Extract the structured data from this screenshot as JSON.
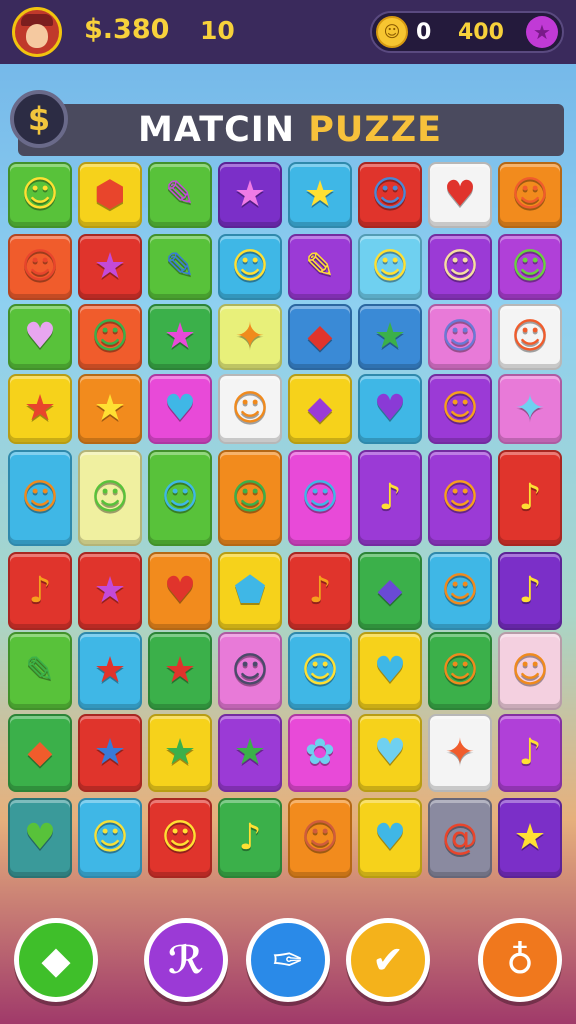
{
  "hud": {
    "money": "$.380",
    "level": "10",
    "coin_icon": "smiley-coin-icon",
    "coins": "0",
    "gems": "400",
    "gem_icon": "purple-star-icon"
  },
  "title": {
    "part1": "MATCIN",
    "part2": "PUZZE",
    "dollar_symbol": "$"
  },
  "board": {
    "rows": [
      [
        {
          "c": "#58c23a",
          "g": "☺",
          "gc": "#ffe033"
        },
        {
          "c": "#f6d21b",
          "g": "⬢",
          "gc": "#e8452c"
        },
        {
          "c": "#58c23a",
          "g": "✎",
          "gc": "#c44ad8"
        },
        {
          "c": "#7b2fc8",
          "g": "★",
          "gc": "#f07be6"
        },
        {
          "c": "#3fb7e6",
          "g": "★",
          "gc": "#ffe033"
        },
        {
          "c": "#e0342c",
          "g": "☺",
          "gc": "#4a88d6"
        },
        {
          "c": "#f4f4f4",
          "g": "♥",
          "gc": "#e0342c"
        },
        {
          "c": "#f28b1d",
          "g": "☺",
          "gc": "#f05c2c"
        }
      ],
      [
        {
          "c": "#f05c2c",
          "g": "☺",
          "gc": "#e8452c"
        },
        {
          "c": "#e0342c",
          "g": "★",
          "gc": "#c44ad8"
        },
        {
          "c": "#58c23a",
          "g": "✎",
          "gc": "#3a7ad6"
        },
        {
          "c": "#3fb7e6",
          "g": "☺",
          "gc": "#ffe033"
        },
        {
          "c": "#9b3ad6",
          "g": "✎",
          "gc": "#ffe033"
        },
        {
          "c": "#6fd0f0",
          "g": "☺",
          "gc": "#ffe033"
        },
        {
          "c": "#9b3ad6",
          "g": "☺",
          "gc": "#f6e0a0"
        },
        {
          "c": "#b040d8",
          "g": "☺",
          "gc": "#6ad040"
        }
      ],
      [
        {
          "c": "#58c23a",
          "g": "♥",
          "gc": "#e7a6f0"
        },
        {
          "c": "#f05c2c",
          "g": "☺",
          "gc": "#3bb04a"
        },
        {
          "c": "#3bb04a",
          "g": "★",
          "gc": "#e84ad8"
        },
        {
          "c": "#e8f07a",
          "g": "✦",
          "gc": "#f08a1d"
        },
        {
          "c": "#3a8ad6",
          "g": "⬥",
          "gc": "#e0342c"
        },
        {
          "c": "#3a8ad6",
          "g": "★",
          "gc": "#3bb04a"
        },
        {
          "c": "#e87ad8",
          "g": "☺",
          "gc": "#6a7ad6"
        },
        {
          "c": "#f4f4f4",
          "g": "☺",
          "gc": "#f05c2c"
        }
      ],
      [
        {
          "c": "#f6d21b",
          "g": "★",
          "gc": "#e8452c"
        },
        {
          "c": "#f28b1d",
          "g": "★",
          "gc": "#ffe033"
        },
        {
          "c": "#e84ad8",
          "g": "♥",
          "gc": "#3fb7e6"
        },
        {
          "c": "#f4f4f4",
          "g": "☺",
          "gc": "#f08a1d"
        },
        {
          "c": "#f6d21b",
          "g": "⬥",
          "gc": "#9b3ad6"
        },
        {
          "c": "#3fb7e6",
          "g": "♥",
          "gc": "#8a3ad6"
        },
        {
          "c": "#9b3ad6",
          "g": "☺",
          "gc": "#f6a01d"
        },
        {
          "c": "#e87ad8",
          "g": "✦",
          "gc": "#6fd0f0"
        }
      ],
      [
        {
          "c": "#3fb7e6",
          "g": "☺",
          "gc": "#f08a1d"
        },
        {
          "c": "#f0f0a0",
          "g": "☺",
          "gc": "#58c23a"
        },
        {
          "c": "#58c23a",
          "g": "☺",
          "gc": "#3fb7e6"
        },
        {
          "c": "#f28b1d",
          "g": "☺",
          "gc": "#3bb04a"
        },
        {
          "c": "#e84ad8",
          "g": "☺",
          "gc": "#3fb7e6"
        },
        {
          "c": "#9b3ad6",
          "g": "♪",
          "gc": "#ffe033"
        },
        {
          "c": "#9b3ad6",
          "g": "☺",
          "gc": "#f6a01d"
        },
        {
          "c": "#e0342c",
          "g": "♪",
          "gc": "#ffe033"
        }
      ],
      [
        {
          "c": "#e0342c",
          "g": "♪",
          "gc": "#f6a01d"
        },
        {
          "c": "#e0342c",
          "g": "★",
          "gc": "#c44ad8"
        },
        {
          "c": "#f28b1d",
          "g": "♥",
          "gc": "#e0342c"
        },
        {
          "c": "#f6d21b",
          "g": "⬟",
          "gc": "#3fb7e6"
        },
        {
          "c": "#e0342c",
          "g": "♪",
          "gc": "#f6a01d"
        },
        {
          "c": "#3bb04a",
          "g": "⬥",
          "gc": "#6a4ad6"
        },
        {
          "c": "#3fb7e6",
          "g": "☺",
          "gc": "#f08a1d"
        },
        {
          "c": "#7b2fc8",
          "g": "♪",
          "gc": "#ffe033"
        }
      ],
      [
        {
          "c": "#58c23a",
          "g": "✎",
          "gc": "#3bb04a"
        },
        {
          "c": "#3fb7e6",
          "g": "★",
          "gc": "#e0342c"
        },
        {
          "c": "#3bb04a",
          "g": "★",
          "gc": "#e0342c"
        },
        {
          "c": "#e87ad8",
          "g": "☺",
          "gc": "#4a4a6a"
        },
        {
          "c": "#3fb7e6",
          "g": "☺",
          "gc": "#ffe033"
        },
        {
          "c": "#f6d21b",
          "g": "♥",
          "gc": "#3fb7e6"
        },
        {
          "c": "#3bb04a",
          "g": "☺",
          "gc": "#f08a1d"
        },
        {
          "c": "#f4d0e0",
          "g": "☺",
          "gc": "#f08a1d"
        }
      ],
      [
        {
          "c": "#3bb04a",
          "g": "⬥",
          "gc": "#f05c2c"
        },
        {
          "c": "#e0342c",
          "g": "★",
          "gc": "#3a7ad6"
        },
        {
          "c": "#f6d21b",
          "g": "★",
          "gc": "#3bb04a"
        },
        {
          "c": "#9b3ad6",
          "g": "★",
          "gc": "#3bb04a"
        },
        {
          "c": "#e84ad8",
          "g": "✿",
          "gc": "#6fd0f0"
        },
        {
          "c": "#f6d21b",
          "g": "♥",
          "gc": "#6fd0f0"
        },
        {
          "c": "#f4f4f4",
          "g": "✦",
          "gc": "#f05c2c"
        },
        {
          "c": "#b040d8",
          "g": "♪",
          "gc": "#ffe033"
        }
      ],
      [
        {
          "c": "#3a9a9a",
          "g": "♥",
          "gc": "#58c23a"
        },
        {
          "c": "#3fb7e6",
          "g": "☺",
          "gc": "#f6e03a"
        },
        {
          "c": "#e0342c",
          "g": "☺",
          "gc": "#ffe033"
        },
        {
          "c": "#3bb04a",
          "g": "♪",
          "gc": "#ffe033"
        },
        {
          "c": "#f28b1d",
          "g": "☺",
          "gc": "#d05c3c"
        },
        {
          "c": "#f6d21b",
          "g": "♥",
          "gc": "#3fb7e6"
        },
        {
          "c": "#8a8aa0",
          "g": "@",
          "gc": "#e8452c"
        },
        {
          "c": "#7b2fc8",
          "g": "★",
          "gc": "#ffe033"
        }
      ]
    ]
  },
  "actions": [
    {
      "name": "diamond-action-button",
      "icon": "diamond-icon",
      "glyph": "◆",
      "color": "#3fbf2a"
    },
    {
      "name": "shuffle-action-button",
      "icon": "shuffle-icon",
      "glyph": "ℛ",
      "color": "#9b3ad6"
    },
    {
      "name": "feather-action-button",
      "icon": "feather-icon",
      "glyph": "✑",
      "color": "#2a8ae8"
    },
    {
      "name": "check-action-button",
      "icon": "check-icon",
      "glyph": "✔",
      "color": "#f4b21b"
    },
    {
      "name": "key-action-button",
      "icon": "key-icon",
      "glyph": "♁",
      "color": "#f0781d"
    }
  ]
}
